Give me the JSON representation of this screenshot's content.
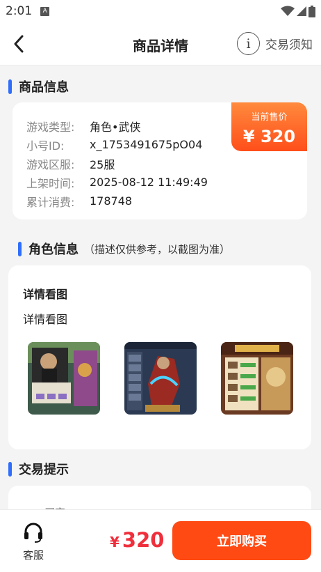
{
  "status_bar": {
    "time": "2:01",
    "notification_letter": "A"
  },
  "nav": {
    "title": "商品详情",
    "notice_label": "交易须知",
    "notice_glyph": "i"
  },
  "product_info": {
    "title": "商品信息",
    "rows": [
      {
        "label": "游戏类型:",
        "value": "角色•武侠"
      },
      {
        "label": "小号ID:",
        "value": "x_1753491675pO04"
      },
      {
        "label": "游戏区服:",
        "value": "25服"
      },
      {
        "label": "上架时间:",
        "value": "2025-08-12 11:49:49"
      },
      {
        "label": "累计消费:",
        "value": "178748"
      }
    ],
    "price_badge": {
      "label": "当前售价",
      "value": "¥ 320"
    }
  },
  "role_info": {
    "title": "角色信息",
    "note": "（描述仅供参考，以截图为准）",
    "heading": "详情看图",
    "subheading": "详情看图",
    "thumbnail_count": 3
  },
  "trade_tips": {
    "title": "交易提示",
    "partial_text": "一、买家"
  },
  "bottom_bar": {
    "service_label": "客服",
    "price_symbol": "¥",
    "price_value": "320",
    "buy_label": "立即购买"
  },
  "colors": {
    "accent_blue": "#2f6dfd",
    "buy_orange": "#ff4a14",
    "price_red": "#ef2f3c"
  }
}
